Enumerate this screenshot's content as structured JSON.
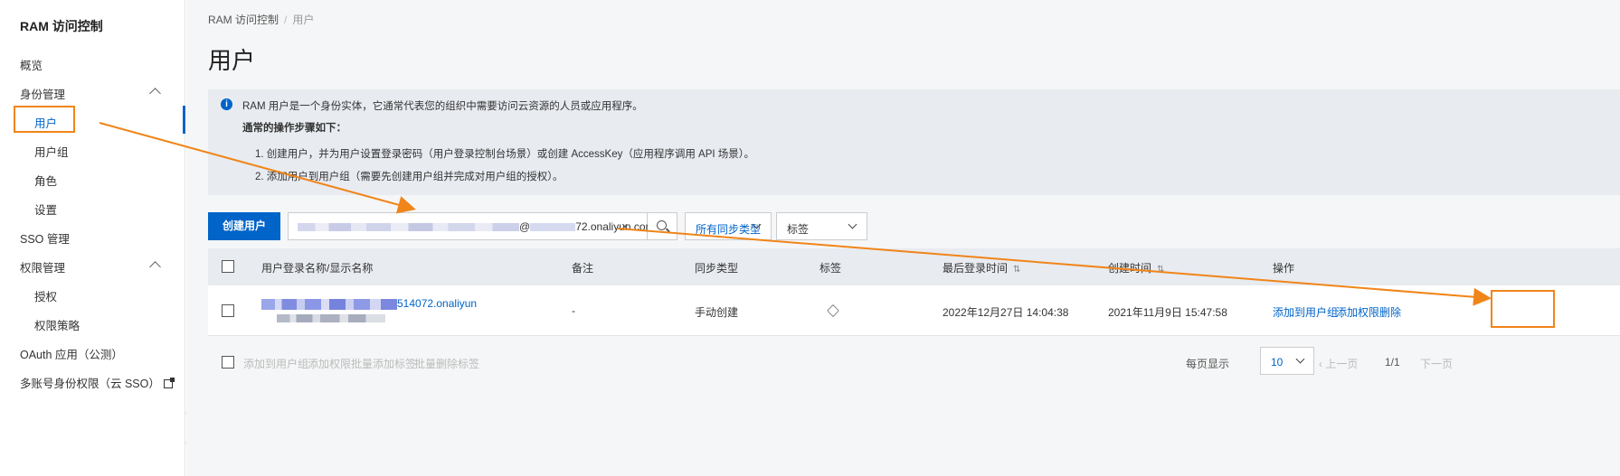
{
  "sidebar": {
    "brand": "RAM 访问控制",
    "items": [
      {
        "label": "概览"
      },
      {
        "label": "身份管理"
      },
      {
        "label": "用户"
      },
      {
        "label": "用户组"
      },
      {
        "label": "角色"
      },
      {
        "label": "设置"
      },
      {
        "label": "SSO 管理"
      },
      {
        "label": "权限管理"
      },
      {
        "label": "授权"
      },
      {
        "label": "权限策略"
      },
      {
        "label": "OAuth 应用（公测）"
      },
      {
        "label": "多账号身份权限（云 SSO）"
      }
    ]
  },
  "breadcrumb": {
    "root": "RAM 访问控制",
    "sep": "/",
    "current": "用户"
  },
  "page_title": "用户",
  "info": {
    "icon": "i",
    "line1": "RAM 用户是一个身份实体，它通常代表您的组织中需要访问云资源的人员或应用程序。",
    "line2": "通常的操作步骤如下：",
    "line3": "1. 创建用户，并为用户设置登录密码（用户登录控制台场景）或创建 AccessKey（应用程序调用 API 场景）。",
    "line4": "2. 添加用户到用户组（需要先创建用户组并完成对用户组的授权）。"
  },
  "toolbar": {
    "create_label": "创建用户",
    "search_visible_at": "@",
    "search_visible_suffix": "72.onaliyun.com",
    "clear_icon": "×",
    "sync_type_label": "所有同步类型",
    "tag_label": "标签"
  },
  "table": {
    "headers": {
      "name": "用户登录名称/显示名称",
      "remark": "备注",
      "sync_type": "同步类型",
      "tag": "标签",
      "last_login": "最后登录时间",
      "created": "创建时间",
      "actions": "操作"
    },
    "sort_icon": "⇅",
    "rows": [
      {
        "name_suffix": "514072.onaliyun",
        "remark": "-",
        "sync_type": "手动创建",
        "last_login": "2022年12月27日 14:04:38",
        "created": "2021年11月9日 15:47:58",
        "action_add_group": "添加到用户组",
        "action_add_perm": "添加权限",
        "action_delete": "删除"
      }
    ]
  },
  "batch": {
    "add_group": "添加到用户组",
    "add_perm": "添加权限",
    "batch_add_tag": "批量添加标签",
    "batch_del_tag": "批量删除标签"
  },
  "pagination": {
    "per_page_label": "每页显示",
    "per_page_value": "10",
    "prev": "上一页",
    "page": "1/1",
    "next": "下一页"
  },
  "colors": {
    "accent": "#0064c8",
    "annotation": "#f08519"
  }
}
